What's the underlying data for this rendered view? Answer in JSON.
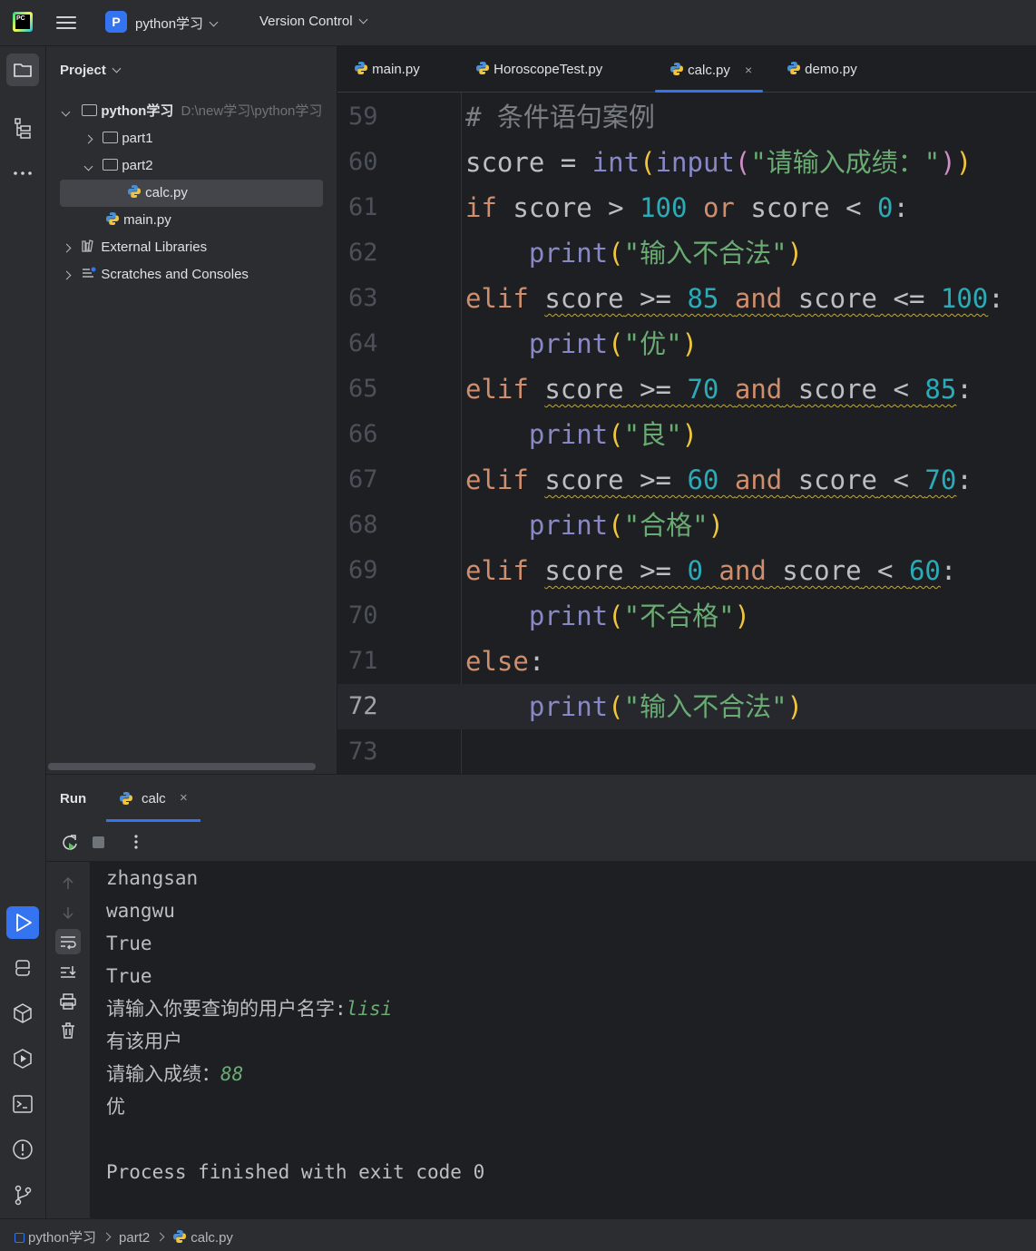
{
  "topbar": {
    "project_badge": "P",
    "project_name": "python学习",
    "vcs": "Version Control"
  },
  "project_panel": {
    "title": "Project",
    "root_name": "python学习",
    "root_path": "D:\\new学习\\python学习",
    "items": [
      {
        "label": "part1"
      },
      {
        "label": "part2"
      },
      {
        "label": "calc.py"
      },
      {
        "label": "main.py"
      },
      {
        "label": "External Libraries"
      },
      {
        "label": "Scratches and Consoles"
      }
    ]
  },
  "editor": {
    "tabs": [
      {
        "label": "main.py"
      },
      {
        "label": "HoroscopeTest.py"
      },
      {
        "label": "calc.py"
      },
      {
        "label": "demo.py"
      }
    ],
    "close_glyph": "×",
    "line_numbers": [
      "59",
      "60",
      "61",
      "62",
      "63",
      "64",
      "65",
      "66",
      "67",
      "68",
      "69",
      "70",
      "71",
      "72",
      "73"
    ],
    "current_line": "72",
    "tokens": {
      "comment": "# 条件语句案例",
      "score": "score",
      "assign": " = ",
      "int": "int",
      "input": "input",
      "lparen": "(",
      "rparen": ")",
      "prompt": "\"请输入成绩：\"",
      "if": "if",
      "elif": "elif",
      "else": "else",
      "or": "or",
      "and": "and",
      "print": "print",
      "colon": ":",
      "gt": " > ",
      "lt": " < ",
      "ge": " >= ",
      "le": " <= ",
      "n100": "100",
      "n85": "85",
      "n70": "70",
      "n60": "60",
      "n0": "0",
      "s_invalid": "\"输入不合法\"",
      "s_excellent": "\"优\"",
      "s_good": "\"良\"",
      "s_pass": "\"合格\"",
      "s_fail": "\"不合格\""
    }
  },
  "run_panel": {
    "title": "Run",
    "tab": "calc",
    "close_glyph": "×",
    "output": [
      {
        "text": "zhangsan"
      },
      {
        "text": "wangwu"
      },
      {
        "text": "True"
      },
      {
        "text": "True"
      },
      {
        "text": "请输入你要查询的用户名字:",
        "input": "lisi"
      },
      {
        "text": "有该用户"
      },
      {
        "text": "请输入成绩：",
        "input": "88"
      },
      {
        "text": "优"
      },
      {
        "text": ""
      },
      {
        "text": "Process finished with exit code 0"
      }
    ]
  },
  "statusbar": {
    "crumbs": [
      "python学习",
      "part2",
      "calc.py"
    ]
  },
  "colors": {
    "accent": "#3574f0",
    "keyword": "#cf8e6d",
    "string": "#6aab73",
    "number": "#2aacb8",
    "builtin": "#8888c6",
    "function": "#56a8f5"
  }
}
